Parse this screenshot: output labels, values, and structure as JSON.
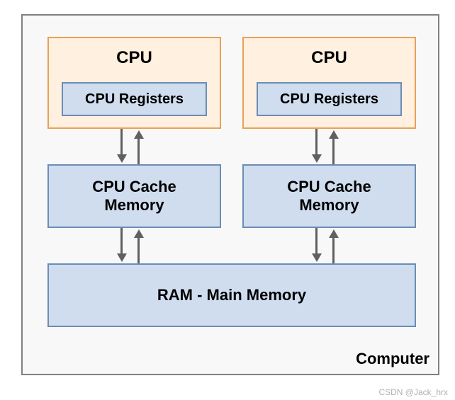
{
  "computer": {
    "label": "Computer",
    "cpus": [
      {
        "title": "CPU",
        "registers": "CPU Registers"
      },
      {
        "title": "CPU",
        "registers": "CPU Registers"
      }
    ],
    "caches": [
      {
        "label": "CPU Cache\nMemory"
      },
      {
        "label": "CPU Cache\nMemory"
      }
    ],
    "ram": {
      "label": "RAM - Main Memory"
    }
  },
  "watermark": "CSDN @Jack_hrx"
}
